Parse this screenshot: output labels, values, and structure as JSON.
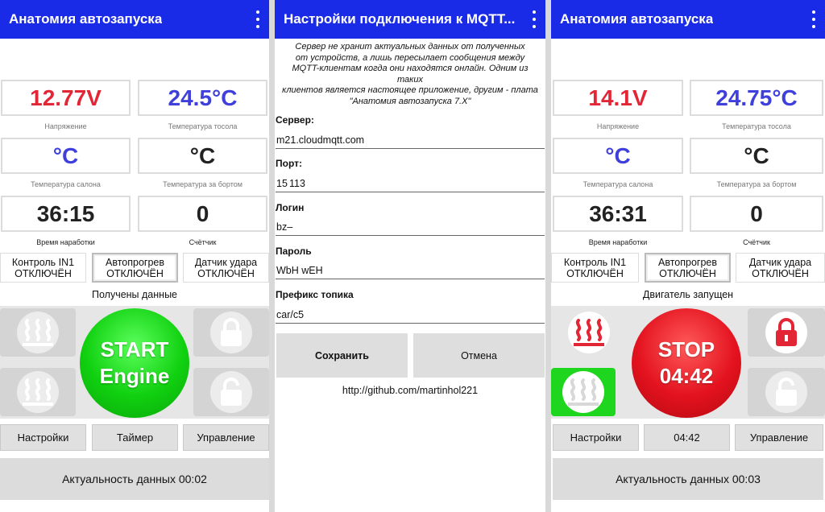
{
  "colors": {
    "appbar": "#1a2be8",
    "voltage": "#e32636",
    "temperature": "#3f3fdc",
    "start_button": "#10d010",
    "stop_button": "#e3121e",
    "active_heater": "#1fd61f"
  },
  "screen1": {
    "title": "Анатомия автозапуска",
    "voltage": "12.77V",
    "voltage_label": "Напряжение",
    "coolant_temp": "24.5°C",
    "coolant_label": "Температура тосола",
    "cabin_temp": "°C",
    "cabin_label": "Температура салона",
    "outside_temp": "°C",
    "outside_label": "Температура за бортом",
    "runtime": "36:15",
    "runtime_label": "Время наработки",
    "counter": "0",
    "counter_label": "Счётчик",
    "in1_line1": "Контроль IN1",
    "in1_line2": "ОТКЛЮЧЁН",
    "preheat_line1": "Автопрогрев",
    "preheat_line2": "ОТКЛЮЧЁН",
    "shock_line1": "Датчик удара",
    "shock_line2": "ОТКЛЮЧЁН",
    "status": "Получены данные",
    "big_line1": "START",
    "big_line2": "Engine",
    "btn_settings": "Настройки",
    "btn_timer": "Таймер",
    "btn_control": "Управление",
    "footer": "Актуальность данных 00:02"
  },
  "screen2": {
    "title": "Настройки подключения к MQTT...",
    "info_lines": [
      "Сервер не хранит актуальных данных от полученных",
      "от устройств, а лишь пересылает сообщения между",
      "MQTT-клиентам когда они находятся онлайн. Одним из таких",
      "клиентов является настоящее приложение, другим - плата",
      "\"Анатомия автозапуска 7.X\""
    ],
    "server_label": "Сервер:",
    "server_value": "m21.cloudmqtt.com",
    "port_label": "Порт:",
    "port_value": "15  113",
    "login_label": "Логин",
    "login_value": "bz‒",
    "password_label": "Пароль",
    "password_value": "WbH        wEH",
    "prefix_label": "Префикс топика",
    "prefix_value": "car/c5",
    "save": "Сохранить",
    "cancel": "Отмена",
    "link": "http://github.com/martinhol221"
  },
  "screen3": {
    "title": "Анатомия автозапуска",
    "voltage": "14.1V",
    "voltage_label": "Напряжение",
    "coolant_temp": "24.75°C",
    "coolant_label": "Температура тосола",
    "cabin_temp": "°C",
    "cabin_label": "Температура салона",
    "outside_temp": "°C",
    "outside_label": "Температура за бортом",
    "runtime": "36:31",
    "runtime_label": "Время наработки",
    "counter": "0",
    "counter_label": "Счётчик",
    "in1_line1": "Контроль IN1",
    "in1_line2": "ОТКЛЮЧЁН",
    "preheat_line1": "Автопрогрев",
    "preheat_line2": "ОТКЛЮЧЁН",
    "shock_line1": "Датчик удара",
    "shock_line2": "ОТКЛЮЧЁН",
    "status": "Двигатель запущен",
    "big_line1": "STOP",
    "big_line2": "04:42",
    "btn_settings": "Настройки",
    "btn_timer": "04:42",
    "btn_control": "Управление",
    "footer": "Актуальность данных 00:03"
  }
}
